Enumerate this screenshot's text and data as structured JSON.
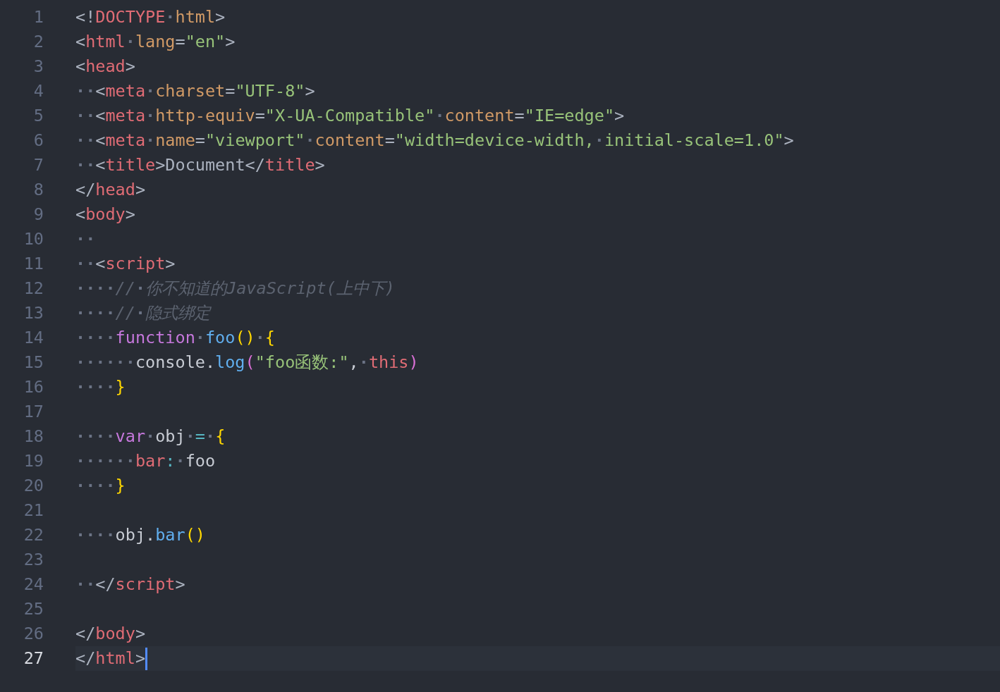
{
  "editor": {
    "lines": [
      {
        "number": "1",
        "current": false,
        "tokens": [
          {
            "kind": "punct",
            "text": "<!"
          },
          {
            "kind": "tag",
            "text": "DOCTYPE"
          },
          {
            "kind": "ws",
            "text": "·"
          },
          {
            "kind": "attr",
            "text": "html"
          },
          {
            "kind": "punct",
            "text": ">"
          }
        ]
      },
      {
        "number": "2",
        "current": false,
        "tokens": [
          {
            "kind": "punct",
            "text": "<"
          },
          {
            "kind": "tag",
            "text": "html"
          },
          {
            "kind": "ws",
            "text": "·"
          },
          {
            "kind": "attr",
            "text": "lang"
          },
          {
            "kind": "punct",
            "text": "="
          },
          {
            "kind": "string",
            "text": "\"en\""
          },
          {
            "kind": "punct",
            "text": ">"
          }
        ]
      },
      {
        "number": "3",
        "current": false,
        "tokens": [
          {
            "kind": "punct",
            "text": "<"
          },
          {
            "kind": "tag",
            "text": "head"
          },
          {
            "kind": "punct",
            "text": ">"
          }
        ]
      },
      {
        "number": "4",
        "current": false,
        "tokens": [
          {
            "kind": "ws",
            "text": "··"
          },
          {
            "kind": "punct",
            "text": "<"
          },
          {
            "kind": "tag",
            "text": "meta"
          },
          {
            "kind": "ws",
            "text": "·"
          },
          {
            "kind": "attr",
            "text": "charset"
          },
          {
            "kind": "punct",
            "text": "="
          },
          {
            "kind": "string",
            "text": "\"UTF-8\""
          },
          {
            "kind": "punct",
            "text": ">"
          }
        ]
      },
      {
        "number": "5",
        "current": false,
        "tokens": [
          {
            "kind": "ws",
            "text": "··"
          },
          {
            "kind": "punct",
            "text": "<"
          },
          {
            "kind": "tag",
            "text": "meta"
          },
          {
            "kind": "ws",
            "text": "·"
          },
          {
            "kind": "attr",
            "text": "http-equiv"
          },
          {
            "kind": "punct",
            "text": "="
          },
          {
            "kind": "string",
            "text": "\"X-UA-Compatible\""
          },
          {
            "kind": "ws",
            "text": "·"
          },
          {
            "kind": "attr",
            "text": "content"
          },
          {
            "kind": "punct",
            "text": "="
          },
          {
            "kind": "string",
            "text": "\"IE=edge\""
          },
          {
            "kind": "punct",
            "text": ">"
          }
        ]
      },
      {
        "number": "6",
        "current": false,
        "tokens": [
          {
            "kind": "ws",
            "text": "··"
          },
          {
            "kind": "punct",
            "text": "<"
          },
          {
            "kind": "tag",
            "text": "meta"
          },
          {
            "kind": "ws",
            "text": "·"
          },
          {
            "kind": "attr",
            "text": "name"
          },
          {
            "kind": "punct",
            "text": "="
          },
          {
            "kind": "string",
            "text": "\"viewport\""
          },
          {
            "kind": "ws",
            "text": "·"
          },
          {
            "kind": "attr",
            "text": "content"
          },
          {
            "kind": "punct",
            "text": "="
          },
          {
            "kind": "string",
            "text": "\"width=device-width,"
          },
          {
            "kind": "ws",
            "text": "·"
          },
          {
            "kind": "string",
            "text": "initial-scale=1.0\""
          },
          {
            "kind": "punct",
            "text": ">"
          }
        ]
      },
      {
        "number": "7",
        "current": false,
        "tokens": [
          {
            "kind": "ws",
            "text": "··"
          },
          {
            "kind": "punct",
            "text": "<"
          },
          {
            "kind": "tag",
            "text": "title"
          },
          {
            "kind": "punct",
            "text": ">Document</"
          },
          {
            "kind": "tag",
            "text": "title"
          },
          {
            "kind": "punct",
            "text": ">"
          }
        ]
      },
      {
        "number": "8",
        "current": false,
        "tokens": [
          {
            "kind": "punct",
            "text": "</"
          },
          {
            "kind": "tag",
            "text": "head"
          },
          {
            "kind": "punct",
            "text": ">"
          }
        ]
      },
      {
        "number": "9",
        "current": false,
        "tokens": [
          {
            "kind": "punct",
            "text": "<"
          },
          {
            "kind": "tag",
            "text": "body"
          },
          {
            "kind": "punct",
            "text": ">"
          }
        ]
      },
      {
        "number": "10",
        "current": false,
        "tokens": [
          {
            "kind": "ws",
            "text": "··"
          }
        ]
      },
      {
        "number": "11",
        "current": false,
        "tokens": [
          {
            "kind": "ws",
            "text": "··"
          },
          {
            "kind": "punct",
            "text": "<"
          },
          {
            "kind": "tag",
            "text": "script"
          },
          {
            "kind": "punct",
            "text": ">"
          }
        ]
      },
      {
        "number": "12",
        "current": false,
        "tokens": [
          {
            "kind": "ws",
            "text": "····"
          },
          {
            "kind": "comment",
            "text": "//"
          },
          {
            "kind": "ws",
            "text": "·"
          },
          {
            "kind": "comment",
            "text": "你不知道的JavaScript(上中下)"
          }
        ]
      },
      {
        "number": "13",
        "current": false,
        "tokens": [
          {
            "kind": "ws",
            "text": "····"
          },
          {
            "kind": "comment",
            "text": "//"
          },
          {
            "kind": "ws",
            "text": "·"
          },
          {
            "kind": "comment",
            "text": "隐式绑定"
          }
        ]
      },
      {
        "number": "14",
        "current": false,
        "tokens": [
          {
            "kind": "ws",
            "text": "····"
          },
          {
            "kind": "keyword",
            "text": "function"
          },
          {
            "kind": "ws",
            "text": "·"
          },
          {
            "kind": "function",
            "text": "foo"
          },
          {
            "kind": "brace",
            "text": "()"
          },
          {
            "kind": "ws",
            "text": "·"
          },
          {
            "kind": "brace",
            "text": "{"
          }
        ]
      },
      {
        "number": "15",
        "current": false,
        "tokens": [
          {
            "kind": "ws",
            "text": "······"
          },
          {
            "kind": "plain",
            "text": "console."
          },
          {
            "kind": "function",
            "text": "log"
          },
          {
            "kind": "paren",
            "text": "("
          },
          {
            "kind": "string",
            "text": "\"foo函数:\""
          },
          {
            "kind": "plain",
            "text": ","
          },
          {
            "kind": "ws",
            "text": "·"
          },
          {
            "kind": "tag",
            "text": "this"
          },
          {
            "kind": "paren",
            "text": ")"
          }
        ]
      },
      {
        "number": "16",
        "current": false,
        "tokens": [
          {
            "kind": "ws",
            "text": "····"
          },
          {
            "kind": "brace",
            "text": "}"
          }
        ]
      },
      {
        "number": "17",
        "current": false
      },
      {
        "number": "18",
        "current": false,
        "tokens": [
          {
            "kind": "ws",
            "text": "····"
          },
          {
            "kind": "keyword",
            "text": "var"
          },
          {
            "kind": "ws",
            "text": "·"
          },
          {
            "kind": "plain",
            "text": "obj"
          },
          {
            "kind": "ws",
            "text": "·"
          },
          {
            "kind": "operator",
            "text": "="
          },
          {
            "kind": "ws",
            "text": "·"
          },
          {
            "kind": "brace",
            "text": "{"
          }
        ]
      },
      {
        "number": "19",
        "current": false,
        "tokens": [
          {
            "kind": "ws",
            "text": "······"
          },
          {
            "kind": "tag",
            "text": "bar"
          },
          {
            "kind": "operator",
            "text": ":"
          },
          {
            "kind": "ws",
            "text": "·"
          },
          {
            "kind": "plain",
            "text": "foo"
          }
        ]
      },
      {
        "number": "20",
        "current": false,
        "tokens": [
          {
            "kind": "ws",
            "text": "····"
          },
          {
            "kind": "brace",
            "text": "}"
          }
        ]
      },
      {
        "number": "21",
        "current": false
      },
      {
        "number": "22",
        "current": false,
        "tokens": [
          {
            "kind": "ws",
            "text": "····"
          },
          {
            "kind": "plain",
            "text": "obj."
          },
          {
            "kind": "function",
            "text": "bar"
          },
          {
            "kind": "brace",
            "text": "()"
          }
        ]
      },
      {
        "number": "23",
        "current": false
      },
      {
        "number": "24",
        "current": false,
        "tokens": [
          {
            "kind": "ws",
            "text": "··"
          },
          {
            "kind": "punct",
            "text": "</"
          },
          {
            "kind": "tag",
            "text": "script"
          },
          {
            "kind": "punct",
            "text": ">"
          }
        ]
      },
      {
        "number": "25",
        "current": false
      },
      {
        "number": "26",
        "current": false,
        "tokens": [
          {
            "kind": "punct",
            "text": "</"
          },
          {
            "kind": "tag",
            "text": "body"
          },
          {
            "kind": "punct",
            "text": ">"
          }
        ]
      },
      {
        "number": "27",
        "current": true,
        "tokens": [
          {
            "kind": "punct",
            "text": "</"
          },
          {
            "kind": "tag",
            "text": "html"
          },
          {
            "kind": "punct",
            "text": ">"
          }
        ]
      }
    ]
  }
}
